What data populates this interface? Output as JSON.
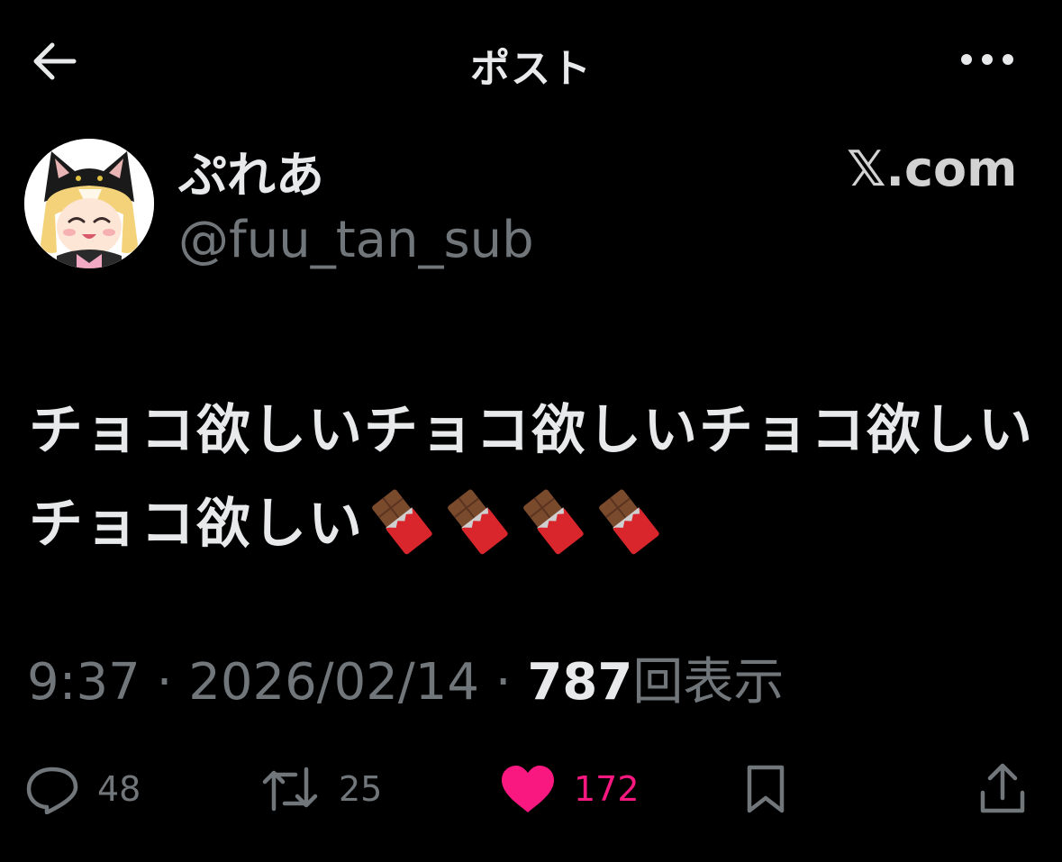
{
  "header": {
    "title": "ポスト",
    "back_icon": "arrow-left-icon",
    "more_icon": "more-horizontal-icon"
  },
  "author": {
    "display_name": "ぷれあ",
    "handle": "@fuu_tan_sub",
    "avatar_icon": "avatar-image"
  },
  "brand": {
    "label": "𝕏.com"
  },
  "post": {
    "text": "チョコ欲しいチョコ欲しいチョコ欲しいチョコ欲しい",
    "emoji": [
      "🍫",
      "🍫",
      "🍫",
      "🍫"
    ]
  },
  "meta": {
    "time": "9:37",
    "separator": "·",
    "date": "2026/02/14",
    "views_count": "787",
    "views_label": "回表示"
  },
  "actions": {
    "reply": {
      "icon": "reply-icon",
      "count": "48"
    },
    "repost": {
      "icon": "repost-icon",
      "count": "25"
    },
    "like": {
      "icon": "heart-filled-icon",
      "count": "172",
      "color": "#f91880"
    },
    "bookmark": {
      "icon": "bookmark-icon"
    },
    "share": {
      "icon": "share-icon"
    }
  },
  "colors": {
    "background": "#000000",
    "primary_text": "#e7e9ea",
    "secondary_text": "#71767b",
    "like_accent": "#f91880"
  }
}
